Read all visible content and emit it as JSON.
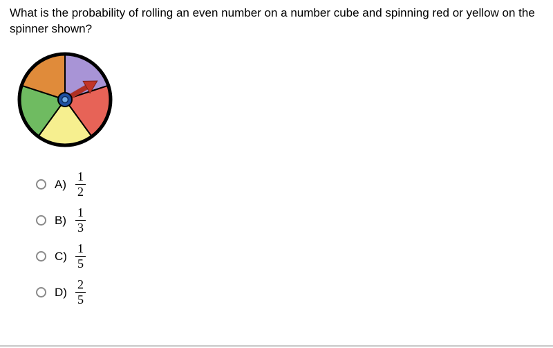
{
  "question": "What is the probability of rolling an even number on a number cube and spinning red or yellow on the spinner shown?",
  "spinner": {
    "sector_colors": [
      "#a894d6",
      "#e76357",
      "#f6ef8f",
      "#6fbb61",
      "#e08b3a"
    ],
    "sector_count": 5,
    "arrow_color": "#c23528"
  },
  "choices": [
    {
      "label": "A)",
      "numerator": "1",
      "denominator": "2"
    },
    {
      "label": "B)",
      "numerator": "1",
      "denominator": "3"
    },
    {
      "label": "C)",
      "numerator": "1",
      "denominator": "5"
    },
    {
      "label": "D)",
      "numerator": "2",
      "denominator": "5"
    }
  ]
}
